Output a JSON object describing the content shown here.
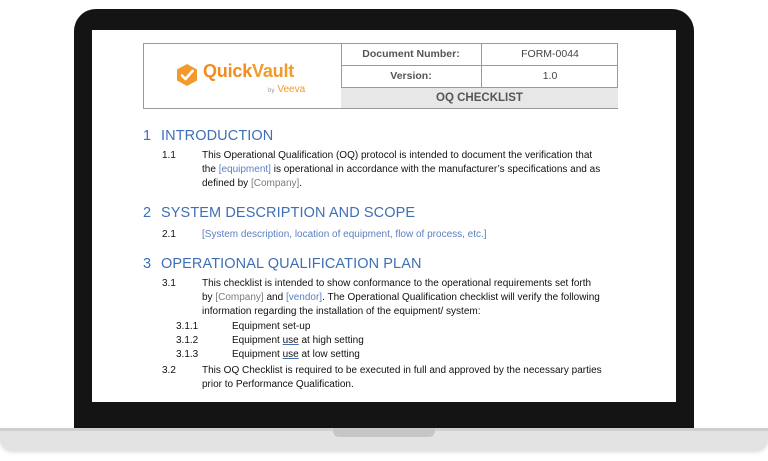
{
  "brand": {
    "name_part1": "Quick",
    "name_part2": "Vault",
    "by": "by",
    "partner": "Veeva",
    "orange": "#f39a2b"
  },
  "header_table": {
    "doc_number_label": "Document Number:",
    "doc_number_value": "FORM-0044",
    "version_label": "Version:",
    "version_value": "1.0",
    "title": "OQ CHECKLIST"
  },
  "sections": [
    {
      "number": "1",
      "title": "INTRODUCTION",
      "items": [
        {
          "num": "1.1",
          "t1": "This Operational Qualification (OQ) protocol is intended to document the verification that",
          "t2a": "the ",
          "t2ph": "[equipment]",
          "t2b": " is operational in accordance with the manufacturer’s specifications and as",
          "t3a": "defined by ",
          "t3ph": "[Company]",
          "t3b": "."
        }
      ]
    },
    {
      "number": "2",
      "title": "SYSTEM DESCRIPTION AND SCOPE",
      "items": [
        {
          "num": "2.1",
          "t1": "[System description, location of equipment, flow of process, etc.]"
        }
      ]
    },
    {
      "number": "3",
      "title": "OPERATIONAL QUALIFICATION PLAN",
      "items": [
        {
          "num": "3.1",
          "t1": "This checklist is intended to show conformance to the operational requirements set forth",
          "t2a": "by ",
          "t2ph": "[Company]",
          "t2b": " and ",
          "t2ph2": "[vendor]",
          "t2c": ". The Operational Qualification checklist will verify the following",
          "t3": "information regarding the installation of the equipment/ system:"
        },
        {
          "num": "3.2",
          "t1": "This OQ Checklist is required to be executed in full and approved by the necessary parties",
          "t2": "prior to Performance Qualification."
        }
      ],
      "subitems": [
        {
          "num": "3.1.1",
          "a": "Equipment set-up",
          "u": "",
          "b": ""
        },
        {
          "num": "3.1.2",
          "a": "Equipment ",
          "u": "use",
          "b": " at high setting"
        },
        {
          "num": "3.1.3",
          "a": "Equipment ",
          "u": "use",
          "b": " at low setting"
        }
      ]
    }
  ]
}
